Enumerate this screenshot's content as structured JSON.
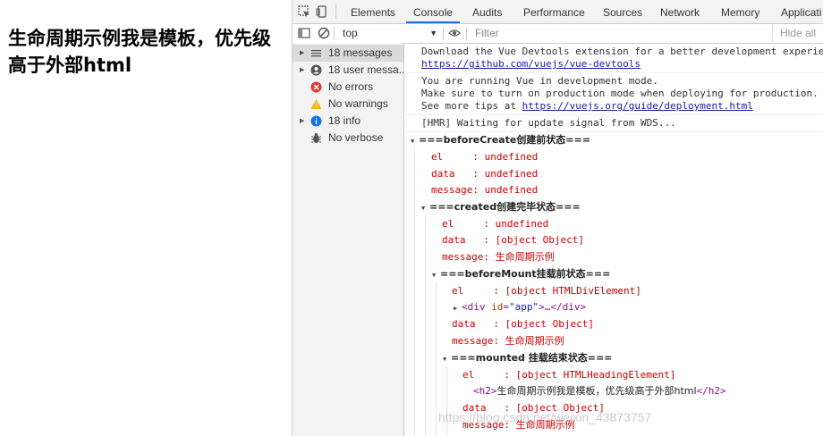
{
  "page": {
    "heading": "生命周期示例我是模板，优先级高于外部html"
  },
  "devtools": {
    "tabs": [
      "Elements",
      "Console",
      "Audits",
      "Performance",
      "Sources",
      "Network",
      "Memory",
      "Applicati"
    ],
    "active_tab": "Console",
    "accent_color": "#1a73e8",
    "toolbar": {
      "context": "top",
      "filter_placeholder": "Filter",
      "hide_all": "Hide all"
    },
    "sidebar": [
      {
        "label": "18 messages",
        "icon": "list-icon",
        "expandable": true,
        "selected": true
      },
      {
        "label": "18 user messa...",
        "icon": "user-icon",
        "expandable": true
      },
      {
        "label": "No errors",
        "icon": "error-icon",
        "expandable": false
      },
      {
        "label": "No warnings",
        "icon": "warning-icon",
        "expandable": false
      },
      {
        "label": "18 info",
        "icon": "info-icon",
        "expandable": true
      },
      {
        "label": "No verbose",
        "icon": "bug-icon",
        "expandable": false
      }
    ],
    "console": {
      "devtools_msg_line1": "Download the Vue Devtools extension for a better development experie",
      "devtools_msg_link": "https://github.com/vuejs/vue-devtools",
      "devmode_line1": "You are running Vue in development mode.",
      "devmode_line2": "Make sure to turn on production mode when deploying for production.",
      "devmode_line3_prefix": "See more tips at ",
      "devmode_link": "https://vuejs.org/guide/deployment.html",
      "hmr": "[HMR] Waiting for update signal from WDS...",
      "before_create": {
        "title": "===beforeCreate创建前状态===",
        "el": "el     : undefined",
        "data": "data   : undefined",
        "message": "message: undefined"
      },
      "created": {
        "title": "===created创建完毕状态===",
        "el": "el     : undefined",
        "data": "data   : [object Object]",
        "message_prefix": "message: ",
        "message_value": "生命周期示例"
      },
      "before_mount": {
        "title": "===beforeMount挂载前状态===",
        "el": "el     : [object HTMLDivElement]",
        "node_tag_open": "<div",
        "node_attr": "id",
        "node_val": "\"app\"",
        "node_rest": ">…</div>",
        "data": "data   : [object Object]",
        "message_prefix": "message: ",
        "message_value": "生命周期示例"
      },
      "mounted": {
        "title": "===mounted 挂载结束状态===",
        "el": "el     : [object HTMLHeadingElement]",
        "h2_open": "<h2>",
        "h2_text": "生命周期示例我是模板，优先级高于外部html",
        "h2_close": "</h2>",
        "data": "data   : [object Object]",
        "message_prefix": "message: ",
        "message_value": "生命周期示例"
      }
    },
    "watermark": "https://blog.csdn.net/weixin_43873757"
  }
}
